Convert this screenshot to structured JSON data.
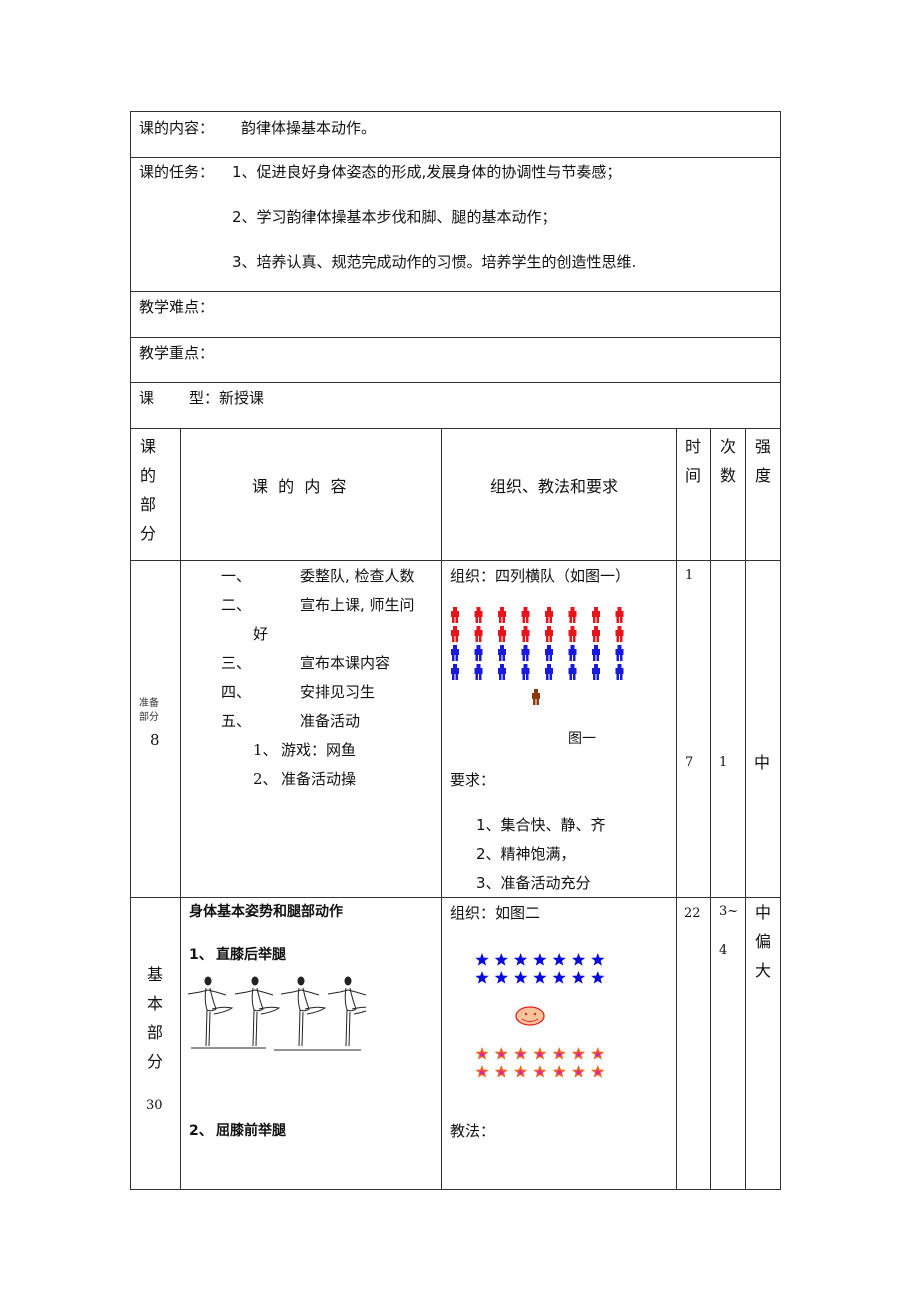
{
  "lesson": {
    "content_label": "课的内容：",
    "content_value": "韵律体操基本动作。",
    "tasks_label": "课的任务：",
    "tasks": [
      "1、促进良好身体姿态的形成,发展身体的协调性与节奏感；",
      "2、学习韵律体操基本步伐和脚、腿的基本动作；",
      "3、培养认真、规范完成动作的习惯。培养学生的创造性思维."
    ],
    "difficulty_label": "教学难点：",
    "difficulty_value": "",
    "key_point_label": "教学重点：",
    "key_point_value": "",
    "type_label_a": "课",
    "type_label_b": "型：新授课"
  },
  "table": {
    "headers": {
      "part": [
        "课",
        "的",
        "部",
        "分"
      ],
      "content": "课  的  内  容",
      "organization": "组织、教法和要求",
      "time": [
        "时",
        "间"
      ],
      "count": [
        "次",
        "数"
      ],
      "intensity": [
        "强",
        "度"
      ]
    },
    "rows": [
      {
        "part_lines": [
          "准备",
          "部分"
        ],
        "part_minutes": "8",
        "content_items": [
          {
            "num": "一、",
            "text": "委整队, 检查人数"
          },
          {
            "num": "二、",
            "text": "宣布上课, 师生问"
          },
          {
            "num": "",
            "text": "好"
          },
          {
            "num": "三、",
            "text": "宣布本课内容"
          },
          {
            "num": "四、",
            "text": "安排见习生"
          },
          {
            "num": "五、",
            "text": "准备活动"
          }
        ],
        "sub_items": [
          {
            "num": "1、",
            "text": "游戏：网鱼"
          },
          {
            "num": "2、",
            "text": "准备活动操"
          }
        ],
        "organization_title": "组织：四列横队（如图一）",
        "figure": {
          "caption": "图一",
          "rows": [
            {
              "color": "#e8141b",
              "count": 8
            },
            {
              "color": "#e8141b",
              "count": 8
            },
            {
              "color": "#1a1adf",
              "count": 8
            },
            {
              "color": "#1a1adf",
              "count": 8
            }
          ],
          "teacher_color": "#8b3a0f"
        },
        "requirements_label": "要求：",
        "requirements": [
          "1、集合快、静、齐",
          "2、精神饱满，",
          "3、准备活动充分"
        ],
        "times": [
          "1",
          "7"
        ],
        "count": "1",
        "intensity": "中"
      },
      {
        "part_lines": [
          "基",
          "本",
          "部",
          "分"
        ],
        "part_minutes": "30",
        "content_title": "身体基本姿势和腿部动作",
        "content_items": [
          {
            "num": "1、",
            "text": "直膝后举腿"
          },
          {
            "num": "2、",
            "text": "屈膝前举腿"
          }
        ],
        "organization_title": "组织：如图二",
        "figure": {
          "top_rows": [
            {
              "color": "#0a0ae0",
              "count": 7
            },
            {
              "color": "#0a0ae0",
              "count": 7
            }
          ],
          "bottom_rows": [
            {
              "color": "#f0601e",
              "count": 7
            },
            {
              "color": "#f0601e",
              "count": 7
            }
          ],
          "teacher_face_fill": "#f9c49a",
          "teacher_face_stroke": "#e32020"
        },
        "method_label": "教法：",
        "time": "22",
        "count": [
          "3~",
          "4"
        ],
        "intensity": [
          "中",
          "偏",
          "大"
        ]
      }
    ]
  }
}
